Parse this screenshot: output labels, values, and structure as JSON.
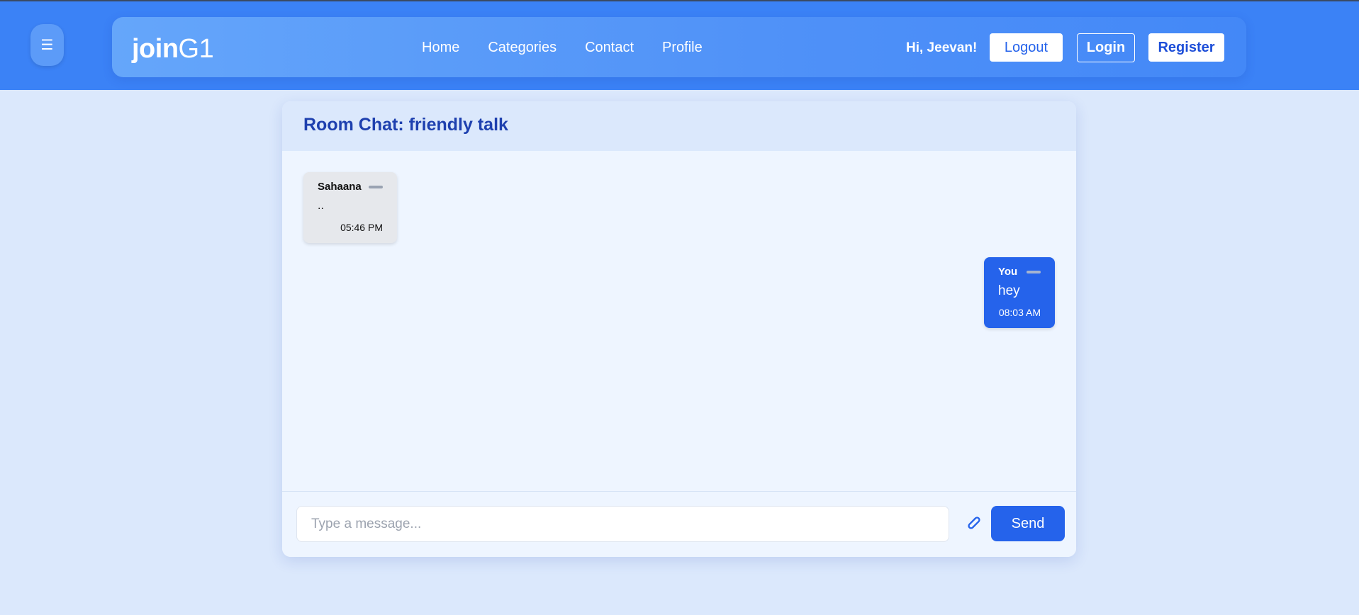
{
  "header": {
    "menu_icon": "☰",
    "brand": {
      "bold": "join",
      "light": "G1"
    },
    "nav": [
      {
        "label": "Home"
      },
      {
        "label": "Categories"
      },
      {
        "label": "Contact"
      },
      {
        "label": "Profile"
      }
    ],
    "greeting": "Hi, Jeevan!",
    "logout_label": "Logout",
    "login_label": "Login",
    "register_label": "Register"
  },
  "chat": {
    "title": "Room Chat: friendly talk",
    "messages": [
      {
        "sender": "Sahaana",
        "text": "..",
        "time": "05:46 PM",
        "direction": "incoming"
      },
      {
        "sender": "You",
        "text": "hey",
        "time": "08:03 AM",
        "direction": "outgoing"
      }
    ],
    "composer": {
      "placeholder": "Type a message...",
      "value": "",
      "attach_icon": "paperclip-icon",
      "send_label": "Send"
    }
  },
  "colors": {
    "accent": "#2563eb",
    "header_bg": "#3b82f6",
    "page_bg": "#dbe8fc",
    "title": "#1e40af",
    "incoming_bubble": "#e6e8ec"
  }
}
